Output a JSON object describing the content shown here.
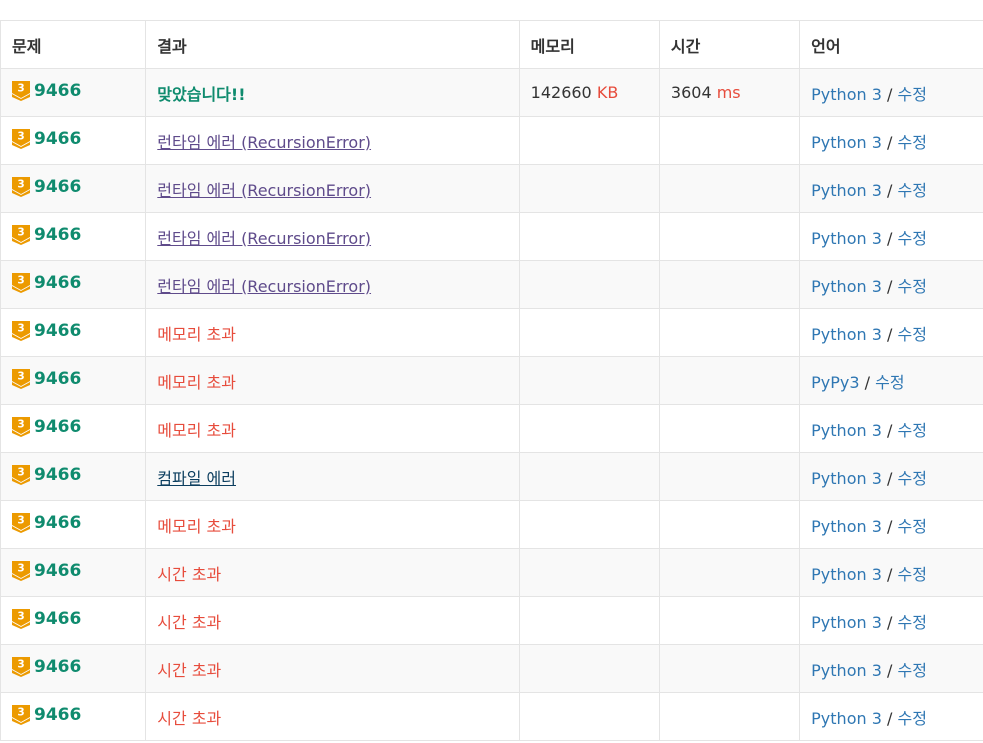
{
  "table": {
    "headers": [
      "문제",
      "결과",
      "메모리",
      "시간",
      "언어"
    ],
    "rows": [
      {
        "tier": "3",
        "problem_id": "9466",
        "result": "맞았습니다!!",
        "result_type": "ac",
        "memory": "142660",
        "memory_unit": "KB",
        "time": "3604",
        "time_unit": "ms",
        "language": "Python 3",
        "separator": "/",
        "edit": "수정"
      },
      {
        "tier": "3",
        "problem_id": "9466",
        "result": "런타임 에러 (RecursionError)",
        "result_type": "rte",
        "memory": "",
        "memory_unit": "",
        "time": "",
        "time_unit": "",
        "language": "Python 3",
        "separator": "/",
        "edit": "수정"
      },
      {
        "tier": "3",
        "problem_id": "9466",
        "result": "런타임 에러 (RecursionError)",
        "result_type": "rte",
        "memory": "",
        "memory_unit": "",
        "time": "",
        "time_unit": "",
        "language": "Python 3",
        "separator": "/",
        "edit": "수정"
      },
      {
        "tier": "3",
        "problem_id": "9466",
        "result": "런타임 에러 (RecursionError)",
        "result_type": "rte",
        "memory": "",
        "memory_unit": "",
        "time": "",
        "time_unit": "",
        "language": "Python 3",
        "separator": "/",
        "edit": "수정"
      },
      {
        "tier": "3",
        "problem_id": "9466",
        "result": "런타임 에러 (RecursionError)",
        "result_type": "rte",
        "memory": "",
        "memory_unit": "",
        "time": "",
        "time_unit": "",
        "language": "Python 3",
        "separator": "/",
        "edit": "수정"
      },
      {
        "tier": "3",
        "problem_id": "9466",
        "result": "메모리 초과",
        "result_type": "mle",
        "memory": "",
        "memory_unit": "",
        "time": "",
        "time_unit": "",
        "language": "Python 3",
        "separator": "/",
        "edit": "수정"
      },
      {
        "tier": "3",
        "problem_id": "9466",
        "result": "메모리 초과",
        "result_type": "mle",
        "memory": "",
        "memory_unit": "",
        "time": "",
        "time_unit": "",
        "language": "PyPy3",
        "separator": "/",
        "edit": "수정"
      },
      {
        "tier": "3",
        "problem_id": "9466",
        "result": "메모리 초과",
        "result_type": "mle",
        "memory": "",
        "memory_unit": "",
        "time": "",
        "time_unit": "",
        "language": "Python 3",
        "separator": "/",
        "edit": "수정"
      },
      {
        "tier": "3",
        "problem_id": "9466",
        "result": "컴파일 에러",
        "result_type": "ce",
        "memory": "",
        "memory_unit": "",
        "time": "",
        "time_unit": "",
        "language": "Python 3",
        "separator": "/",
        "edit": "수정"
      },
      {
        "tier": "3",
        "problem_id": "9466",
        "result": "메모리 초과",
        "result_type": "mle",
        "memory": "",
        "memory_unit": "",
        "time": "",
        "time_unit": "",
        "language": "Python 3",
        "separator": "/",
        "edit": "수정"
      },
      {
        "tier": "3",
        "problem_id": "9466",
        "result": "시간 초과",
        "result_type": "tle",
        "memory": "",
        "memory_unit": "",
        "time": "",
        "time_unit": "",
        "language": "Python 3",
        "separator": "/",
        "edit": "수정"
      },
      {
        "tier": "3",
        "problem_id": "9466",
        "result": "시간 초과",
        "result_type": "tle",
        "memory": "",
        "memory_unit": "",
        "time": "",
        "time_unit": "",
        "language": "Python 3",
        "separator": "/",
        "edit": "수정"
      },
      {
        "tier": "3",
        "problem_id": "9466",
        "result": "시간 초과",
        "result_type": "tle",
        "memory": "",
        "memory_unit": "",
        "time": "",
        "time_unit": "",
        "language": "Python 3",
        "separator": "/",
        "edit": "수정"
      },
      {
        "tier": "3",
        "problem_id": "9466",
        "result": "시간 초과",
        "result_type": "tle",
        "memory": "",
        "memory_unit": "",
        "time": "",
        "time_unit": "",
        "language": "Python 3",
        "separator": "/",
        "edit": "수정"
      }
    ]
  },
  "icons": {
    "tier": "gold-tier-badge-icon"
  },
  "colors": {
    "accepted": "#0f8b6e",
    "runtime_error": "#5f4b8b",
    "memory_limit": "#e74c3c",
    "time_limit": "#e74c3c",
    "compile_error": "#0c3e5f",
    "language_link": "#2f77b3",
    "tier_gold": "#ec9a00"
  }
}
